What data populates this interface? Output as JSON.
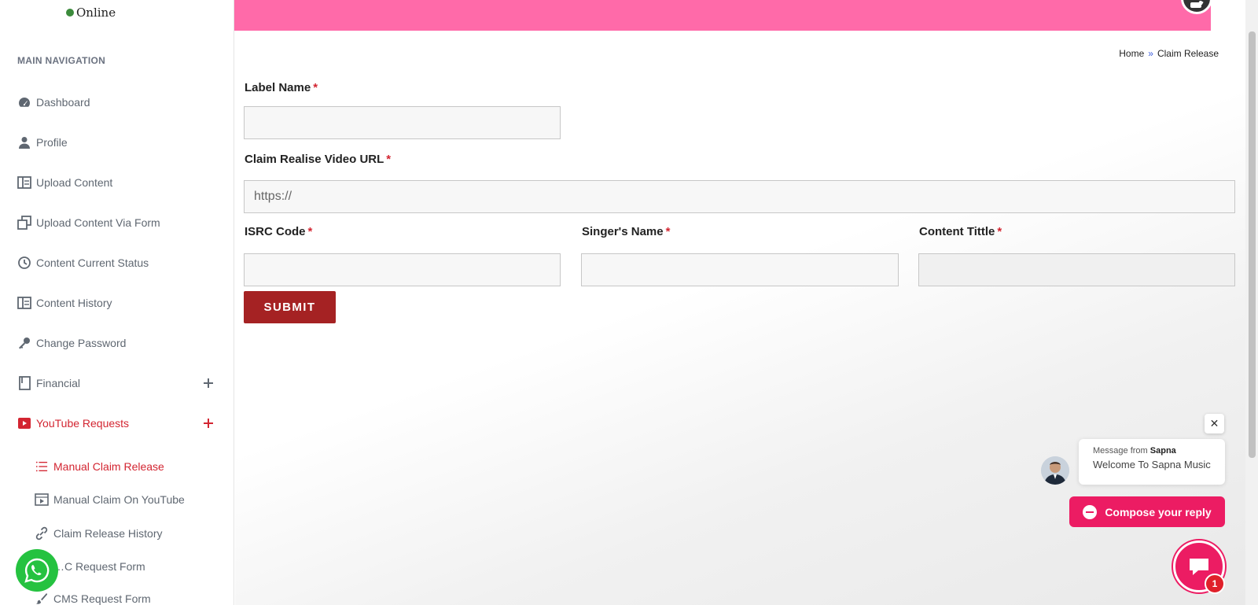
{
  "user": {
    "status": "Online"
  },
  "sidebar": {
    "header": "MAIN NAVIGATION",
    "items": [
      {
        "label": "Dashboard",
        "icon": "dashboard-icon"
      },
      {
        "label": "Profile",
        "icon": "user-icon"
      },
      {
        "label": "Upload Content",
        "icon": "columns-icon"
      },
      {
        "label": "Upload Content Via Form",
        "icon": "clone-icon"
      },
      {
        "label": "Content Current Status",
        "icon": "history-icon"
      },
      {
        "label": "Content History",
        "icon": "columns-icon"
      },
      {
        "label": "Change Password",
        "icon": "key-icon"
      },
      {
        "label": "Financial",
        "icon": "book-icon"
      },
      {
        "label": "YouTube Requests",
        "icon": "youtube-icon"
      }
    ],
    "sub_items": [
      {
        "label": "Manual Claim Release",
        "icon": "list-icon"
      },
      {
        "label": "Manual Claim On YouTube",
        "icon": "film-icon"
      },
      {
        "label": "Claim Release History",
        "icon": "link-icon"
      },
      {
        "label": "…C Request Form",
        "icon": "form-icon"
      },
      {
        "label": "CMS Request Form",
        "icon": "brush-icon"
      }
    ]
  },
  "breadcrumb": {
    "home": "Home",
    "separator": "»",
    "current": "Claim Release"
  },
  "form": {
    "label_name": "Label Name",
    "video_url": "Claim Realise Video URL",
    "video_url_placeholder": "https://",
    "isrc_code": "ISRC Code",
    "singer_name": "Singer's Name",
    "content_title": "Content Tittle",
    "required_mark": "*",
    "submit_label": "SUBMIT"
  },
  "chat": {
    "close": "✕",
    "from_prefix": "Message from",
    "from_name": "Sapna",
    "message": "Welcome To Sapna Music",
    "compose_label": "Compose your reply",
    "badge_count": "1"
  },
  "colors": {
    "topbar": "#ff6aa9",
    "accent_red": "#d32531",
    "submit": "#a52223",
    "chat_pink": "#ec1c63",
    "whatsapp": "#25c240"
  }
}
